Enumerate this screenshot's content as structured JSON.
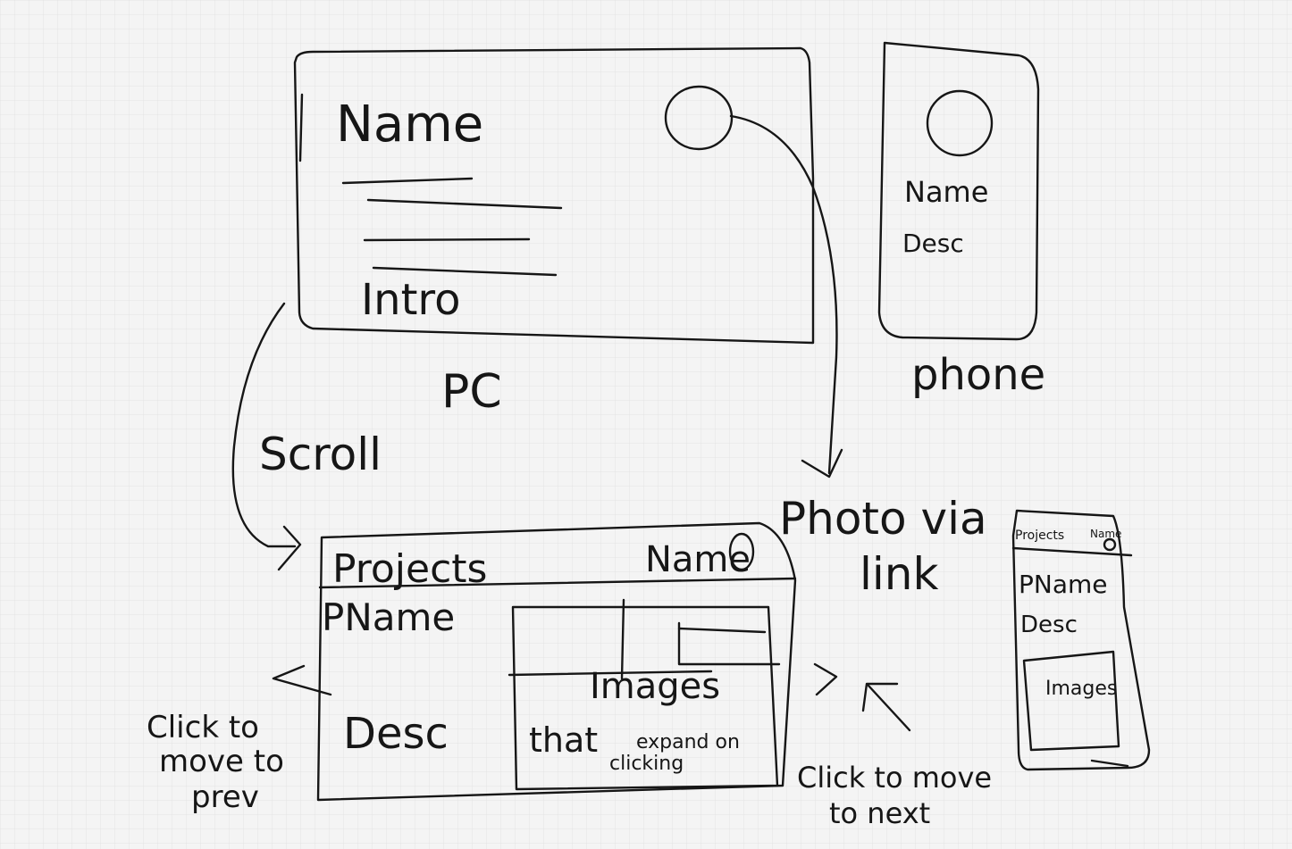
{
  "pc_sketch": {
    "name": "Name",
    "intro": "Intro",
    "caption": "PC"
  },
  "phone_sketch": {
    "name": "Name",
    "desc": "Desc",
    "caption": "phone"
  },
  "annotations": {
    "scroll": "Scroll",
    "photo_via_link": [
      "Photo via",
      "link"
    ],
    "click_prev": [
      "Click to",
      "move to",
      "prev"
    ],
    "click_next": [
      "Click to move",
      "to next"
    ]
  },
  "projects_pc": {
    "header": "Projects",
    "header_name": "Name",
    "pname": "PName",
    "desc": "Desc",
    "images": "Images",
    "images_note": [
      "that",
      "expand on",
      "clicking"
    ]
  },
  "projects_phone": {
    "header": "Projects",
    "header_name": "Name",
    "pname": "PName",
    "desc": "Desc",
    "images": "Images"
  }
}
